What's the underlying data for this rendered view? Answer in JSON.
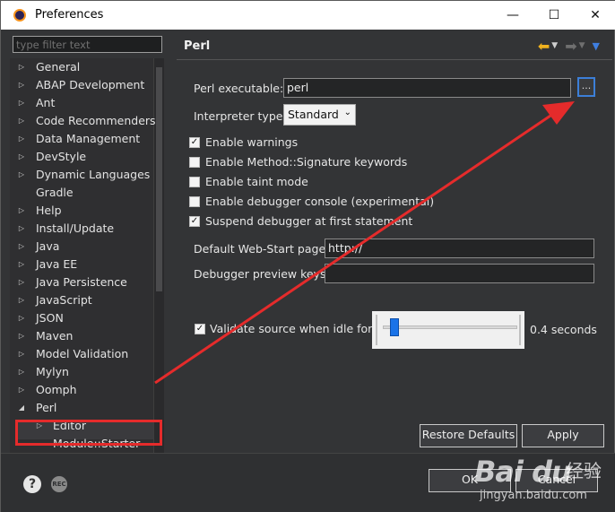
{
  "window": {
    "title": "Preferences",
    "minimize": "—",
    "maximize": "☐",
    "close": "✕"
  },
  "sidebar": {
    "filter_placeholder": "type filter text",
    "items": [
      {
        "label": "General",
        "twisty": "▷"
      },
      {
        "label": "ABAP Development",
        "twisty": "▷"
      },
      {
        "label": "Ant",
        "twisty": "▷"
      },
      {
        "label": "Code Recommenders",
        "twisty": "▷"
      },
      {
        "label": "Data Management",
        "twisty": "▷"
      },
      {
        "label": "DevStyle",
        "twisty": "▷"
      },
      {
        "label": "Dynamic Languages",
        "twisty": "▷"
      },
      {
        "label": "Gradle",
        "twisty": ""
      },
      {
        "label": "Help",
        "twisty": "▷"
      },
      {
        "label": "Install/Update",
        "twisty": "▷"
      },
      {
        "label": "Java",
        "twisty": "▷"
      },
      {
        "label": "Java EE",
        "twisty": "▷"
      },
      {
        "label": "Java Persistence",
        "twisty": "▷"
      },
      {
        "label": "JavaScript",
        "twisty": "▷"
      },
      {
        "label": "JSON",
        "twisty": "▷"
      },
      {
        "label": "Maven",
        "twisty": "▷"
      },
      {
        "label": "Model Validation",
        "twisty": "▷"
      },
      {
        "label": "Mylyn",
        "twisty": "▷"
      },
      {
        "label": "Oomph",
        "twisty": "▷"
      },
      {
        "label": "Perl",
        "twisty": "◢"
      },
      {
        "label": "Editor",
        "twisty": "▷"
      },
      {
        "label": "Module::Starter",
        "twisty": ""
      }
    ]
  },
  "page": {
    "title": "Perl",
    "perl_executable_label": "Perl executable:",
    "perl_executable_value": "perl",
    "browse_label": "...",
    "interpreter_label": "Interpreter type:",
    "interpreter_value": "Standard",
    "checkboxes": [
      {
        "label": "Enable warnings",
        "checked": true,
        "mark": "✓"
      },
      {
        "label": "Enable Method::Signature keywords",
        "checked": false,
        "mark": ""
      },
      {
        "label": "Enable taint mode",
        "checked": false,
        "mark": ""
      },
      {
        "label": "Enable debugger console (experimental)",
        "checked": false,
        "mark": ""
      },
      {
        "label": "Suspend debugger at first statement",
        "checked": true,
        "mark": "✓"
      }
    ],
    "web_start_label": "Default Web-Start page:",
    "web_start_value": "http://",
    "debugger_keys_label": "Debugger preview keys:",
    "debugger_keys_value": "",
    "validate_label": "Validate source when idle for",
    "validate_checked": true,
    "validate_mark": "✓",
    "validate_seconds": "0.4 seconds",
    "slider_level": 0.06,
    "restore_defaults": "Restore Defaults",
    "apply": "Apply"
  },
  "footer": {
    "ok": "OK",
    "cancel": "Cancel",
    "help": "?",
    "rec": "REC"
  },
  "watermark": {
    "logo": "Bai du",
    "sub": "经验",
    "url": "jingyan.baidu.com"
  },
  "colors": {
    "accent": "#1a73e8",
    "highlight": "#e52b2b",
    "nav_back": "#f0b21e"
  }
}
